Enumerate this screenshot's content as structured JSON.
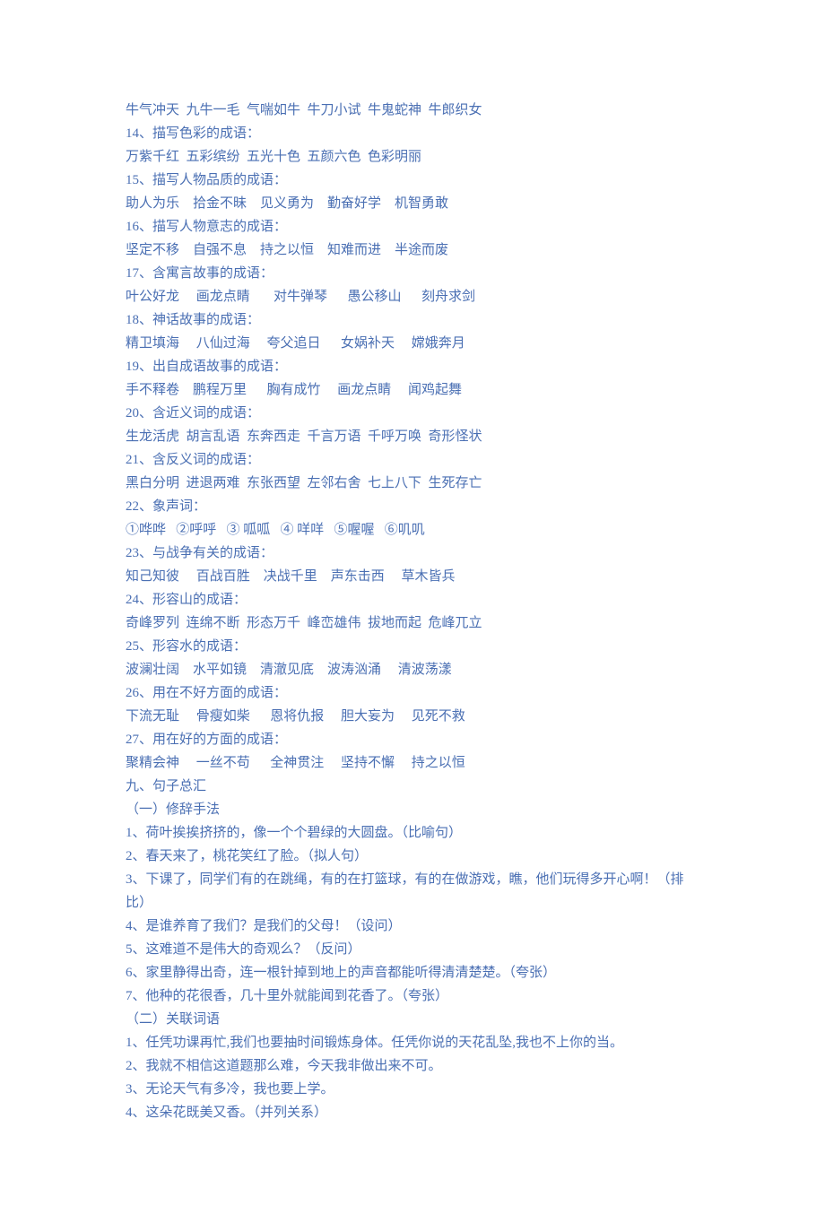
{
  "lines": [
    "牛气冲天  九牛一毛  气喘如牛  牛刀小试  牛鬼蛇神  牛郎织女",
    "14、描写色彩的成语：",
    "万紫千红  五彩缤纷  五光十色  五颜六色  色彩明丽",
    "15、描写人物品质的成语：",
    "助人为乐    拾金不昧    见义勇为    勤奋好学    机智勇敢",
    "16、描写人物意志的成语：",
    "坚定不移    自强不息    持之以恒    知难而进    半途而废",
    "17、含寓言故事的成语：",
    "叶公好龙     画龙点睛       对牛弹琴      愚公移山      刻舟求剑",
    "18、神话故事的成语：",
    "精卫填海     八仙过海     夸父追日      女娲补天     嫦娥奔月",
    "19、出自成语故事的成语：",
    "手不释卷    鹏程万里      胸有成竹     画龙点睛     闻鸡起舞",
    "20、含近义词的成语：",
    "生龙活虎  胡言乱语  东奔西走  千言万语  千呼万唤  奇形怪状",
    "21、含反义词的成语：",
    "黑白分明  进退两难  东张西望  左邻右舍  七上八下  生死存亡",
    "22、象声词：",
    "①哗哗   ②呼呼   ③ 呱呱   ④ 咩咩   ⑤喔喔   ⑥叽叽",
    "23、与战争有关的成语：",
    "知己知彼     百战百胜    决战千里    声东击西     草木皆兵",
    "24、形容山的成语：",
    "奇峰罗列  连绵不断  形态万千  峰峦雄伟  拔地而起  危峰兀立",
    "25、形容水的成语：",
    "波澜壮阔    水平如镜    清澈见底    波涛汹涌     清波荡漾",
    "26、用在不好方面的成语：",
    "下流无耻     骨瘦如柴      恩将仇报     胆大妄为     见死不救",
    "27、用在好的方面的成语：",
    "聚精会神     一丝不苟      全神贯注     坚持不懈     持之以恒",
    "九、句子总汇",
    "（一）修辞手法",
    "1、荷叶挨挨挤挤的，像一个个碧绿的大圆盘。（比喻句）",
    "2、春天来了，桃花笑红了脸。（拟人句）",
    "3、下课了，同学们有的在跳绳，有的在打篮球，有的在做游戏，瞧，他们玩得多开心啊！（排比）",
    "4、是谁养育了我们？是我们的父母！（设问）",
    "5、这难道不是伟大的奇观么？（反问）",
    "6、家里静得出奇，连一根针掉到地上的声音都能听得清清楚楚。（夸张）",
    "7、他种的花很香，几十里外就能闻到花香了。（夸张）",
    "（二）关联词语",
    "1、任凭功课再忙,我们也要抽时间锻炼身体。任凭你说的天花乱坠,我也不上你的当。",
    "2、我就不相信这道题那么难，今天我非做出来不可。",
    "3、无论天气有多冷，我也要上学。",
    "4、这朵花既美又香。（并列关系）"
  ]
}
